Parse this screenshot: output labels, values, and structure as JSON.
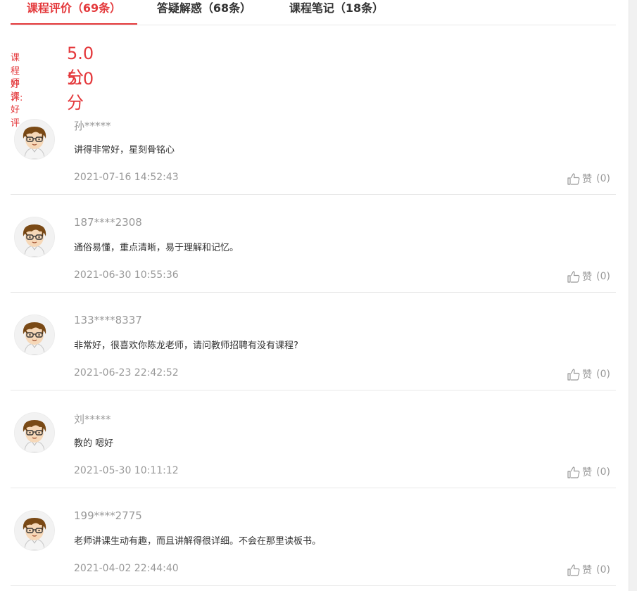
{
  "tabs": [
    {
      "label": "课程评价（69条）",
      "active": true
    },
    {
      "label": "答疑解惑（68条）",
      "active": false
    },
    {
      "label": "课程笔记（18条）",
      "active": false
    }
  ],
  "scores": [
    {
      "label": "课程好评:",
      "value": "5.0 分"
    },
    {
      "label": "师资好评",
      "value": "5.0 分"
    }
  ],
  "like_label": "赞",
  "reviews": [
    {
      "user": "孙*****",
      "content": "讲得非常好，星刻骨铭心",
      "time": "2021-07-16 14:52:43",
      "likes": "(0)"
    },
    {
      "user": "187****2308",
      "content": "通俗易懂，重点清晰，易于理解和记忆。",
      "time": "2021-06-30 10:55:36",
      "likes": "(0)"
    },
    {
      "user": "133****8337",
      "content": "非常好，很喜欢你陈龙老师，请问教师招聘有没有课程?",
      "time": "2021-06-23 22:42:52",
      "likes": "(0)"
    },
    {
      "user": "刘*****",
      "content": "教的 嗯好",
      "time": "2021-05-30 10:11:12",
      "likes": "(0)"
    },
    {
      "user": "199****2775",
      "content": "老师讲课生动有趣，而且讲解得很详细。不会在那里读板书。",
      "time": "2021-04-02 22:44:40",
      "likes": "(0)"
    }
  ],
  "colors": {
    "accent": "#e4393c",
    "muted": "#999999"
  },
  "icons": {
    "avatar": "cartoon-boy-avatar-icon",
    "like": "thumbs-up-icon"
  }
}
